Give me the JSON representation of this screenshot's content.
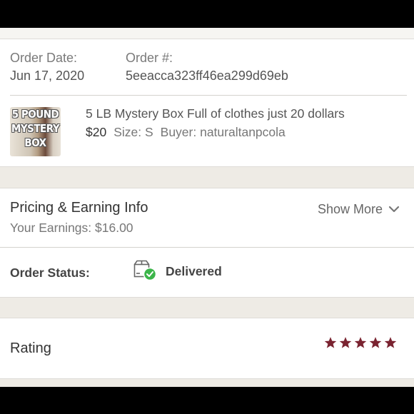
{
  "order": {
    "date_label": "Order Date:",
    "date_value": "Jun 17, 2020",
    "number_label": "Order #:",
    "number_value": "5eeacca323ff46ea299d69eb"
  },
  "item": {
    "thumbnail_text": [
      "5 POUND",
      "MYSTERY",
      "BOX"
    ],
    "title": "5 LB Mystery Box Full of clothes just 20 dollars",
    "price": "$20",
    "size": "Size: S",
    "buyer": "Buyer: naturaltanpcola"
  },
  "pricing": {
    "title": "Pricing & Earning Info",
    "earnings": "Your Earnings: $16.00",
    "show_more_label": "Show More",
    "chevron_icon": "chevron-down-icon"
  },
  "status": {
    "label": "Order Status:",
    "icon": "package-delivered-icon",
    "value": "Delivered",
    "check_color": "#3cb54a"
  },
  "rating": {
    "label": "Rating",
    "stars": 5,
    "star_color": "#7a2330"
  }
}
